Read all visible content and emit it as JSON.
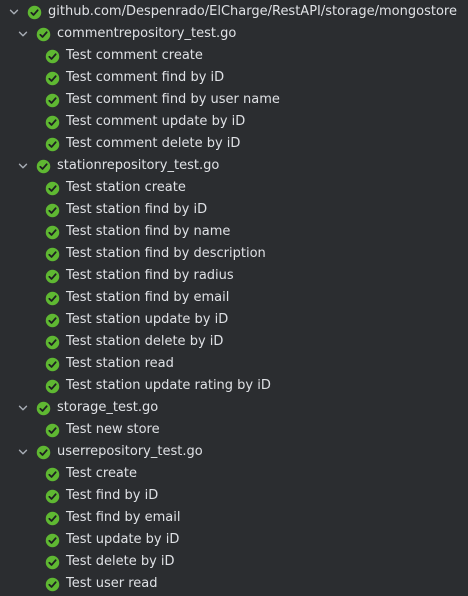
{
  "colors": {
    "pass": "#5fb832",
    "text": "#dfe1e5",
    "background": "#2b2d30",
    "chevron": "#a8adb5"
  },
  "icons": {
    "expand": "chevron-down-icon",
    "status": "check-circle-icon"
  },
  "root": {
    "label": "github.com/Despenrado/ElCharge/RestAPI/storage/mongostore",
    "status": "passed",
    "files": [
      {
        "label": "commentrepository_test.go",
        "status": "passed",
        "tests": [
          {
            "label": "Test comment create",
            "status": "passed"
          },
          {
            "label": "Test comment find by iD",
            "status": "passed"
          },
          {
            "label": "Test comment find by user name",
            "status": "passed"
          },
          {
            "label": "Test comment update by iD",
            "status": "passed"
          },
          {
            "label": "Test comment delete by iD",
            "status": "passed"
          }
        ]
      },
      {
        "label": "stationrepository_test.go",
        "status": "passed",
        "tests": [
          {
            "label": "Test station create",
            "status": "passed"
          },
          {
            "label": "Test station find by iD",
            "status": "passed"
          },
          {
            "label": "Test station find by name",
            "status": "passed"
          },
          {
            "label": "Test station find by description",
            "status": "passed"
          },
          {
            "label": "Test station find by radius",
            "status": "passed"
          },
          {
            "label": "Test station find by email",
            "status": "passed"
          },
          {
            "label": "Test station update by iD",
            "status": "passed"
          },
          {
            "label": "Test station delete by iD",
            "status": "passed"
          },
          {
            "label": "Test station read",
            "status": "passed"
          },
          {
            "label": "Test station update rating by iD",
            "status": "passed"
          }
        ]
      },
      {
        "label": "storage_test.go",
        "status": "passed",
        "tests": [
          {
            "label": "Test new store",
            "status": "passed"
          }
        ]
      },
      {
        "label": "userrepository_test.go",
        "status": "passed",
        "tests": [
          {
            "label": "Test create",
            "status": "passed"
          },
          {
            "label": "Test find by iD",
            "status": "passed"
          },
          {
            "label": "Test find by email",
            "status": "passed"
          },
          {
            "label": "Test update by iD",
            "status": "passed"
          },
          {
            "label": "Test delete by iD",
            "status": "passed"
          },
          {
            "label": "Test user read",
            "status": "passed"
          }
        ]
      }
    ]
  }
}
